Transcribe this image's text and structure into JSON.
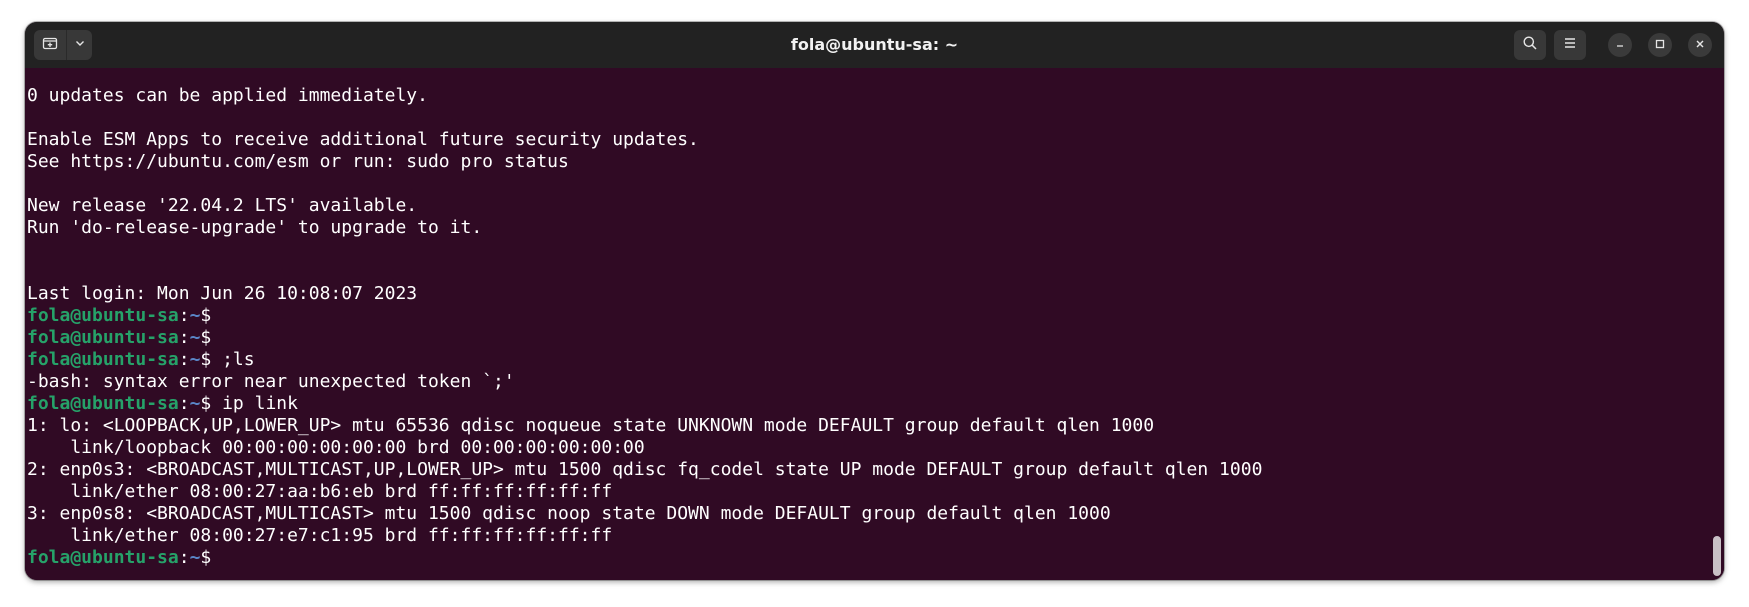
{
  "window": {
    "title": "fola@ubuntu-sa: ~"
  },
  "header_icons": {
    "new_tab": "new-tab-icon",
    "tab_menu": "chevron-down-icon",
    "search": "search-icon",
    "menu": "hamburger-menu-icon",
    "minimize": "minimize-icon",
    "maximize": "maximize-icon",
    "close": "close-icon"
  },
  "colors": {
    "terminal_bg": "#300a24",
    "titlebar_bg": "#222222",
    "prompt_user": "#26a269",
    "prompt_path": "#5a86c7",
    "text": "#ffffff"
  },
  "terminal": {
    "lines": [
      {
        "text": "0 updates can be applied immediately."
      },
      {
        "text": ""
      },
      {
        "text": "Enable ESM Apps to receive additional future security updates."
      },
      {
        "text": "See https://ubuntu.com/esm or run: sudo pro status"
      },
      {
        "text": ""
      },
      {
        "text": "New release '22.04.2 LTS' available."
      },
      {
        "text": "Run 'do-release-upgrade' to upgrade to it."
      },
      {
        "text": ""
      },
      {
        "text": ""
      },
      {
        "text": "Last login: Mon Jun 26 10:08:07 2023"
      },
      {
        "prompt": {
          "user": "fola@ubuntu-sa",
          "sep": ":",
          "path": "~",
          "sym": "$ "
        },
        "cmd": ""
      },
      {
        "prompt": {
          "user": "fola@ubuntu-sa",
          "sep": ":",
          "path": "~",
          "sym": "$ "
        },
        "cmd": ""
      },
      {
        "prompt": {
          "user": "fola@ubuntu-sa",
          "sep": ":",
          "path": "~",
          "sym": "$ "
        },
        "cmd": ";ls"
      },
      {
        "text": "-bash: syntax error near unexpected token `;'"
      },
      {
        "prompt": {
          "user": "fola@ubuntu-sa",
          "sep": ":",
          "path": "~",
          "sym": "$ "
        },
        "cmd": "ip link"
      },
      {
        "text": "1: lo: <LOOPBACK,UP,LOWER_UP> mtu 65536 qdisc noqueue state UNKNOWN mode DEFAULT group default qlen 1000"
      },
      {
        "text": "    link/loopback 00:00:00:00:00:00 brd 00:00:00:00:00:00"
      },
      {
        "text": "2: enp0s3: <BROADCAST,MULTICAST,UP,LOWER_UP> mtu 1500 qdisc fq_codel state UP mode DEFAULT group default qlen 1000"
      },
      {
        "text": "    link/ether 08:00:27:aa:b6:eb brd ff:ff:ff:ff:ff:ff"
      },
      {
        "text": "3: enp0s8: <BROADCAST,MULTICAST> mtu 1500 qdisc noop state DOWN mode DEFAULT group default qlen 1000"
      },
      {
        "text": "    link/ether 08:00:27:e7:c1:95 brd ff:ff:ff:ff:ff:ff"
      },
      {
        "prompt": {
          "user": "fola@ubuntu-sa",
          "sep": ":",
          "path": "~",
          "sym": "$ "
        },
        "cmd": ""
      }
    ]
  }
}
